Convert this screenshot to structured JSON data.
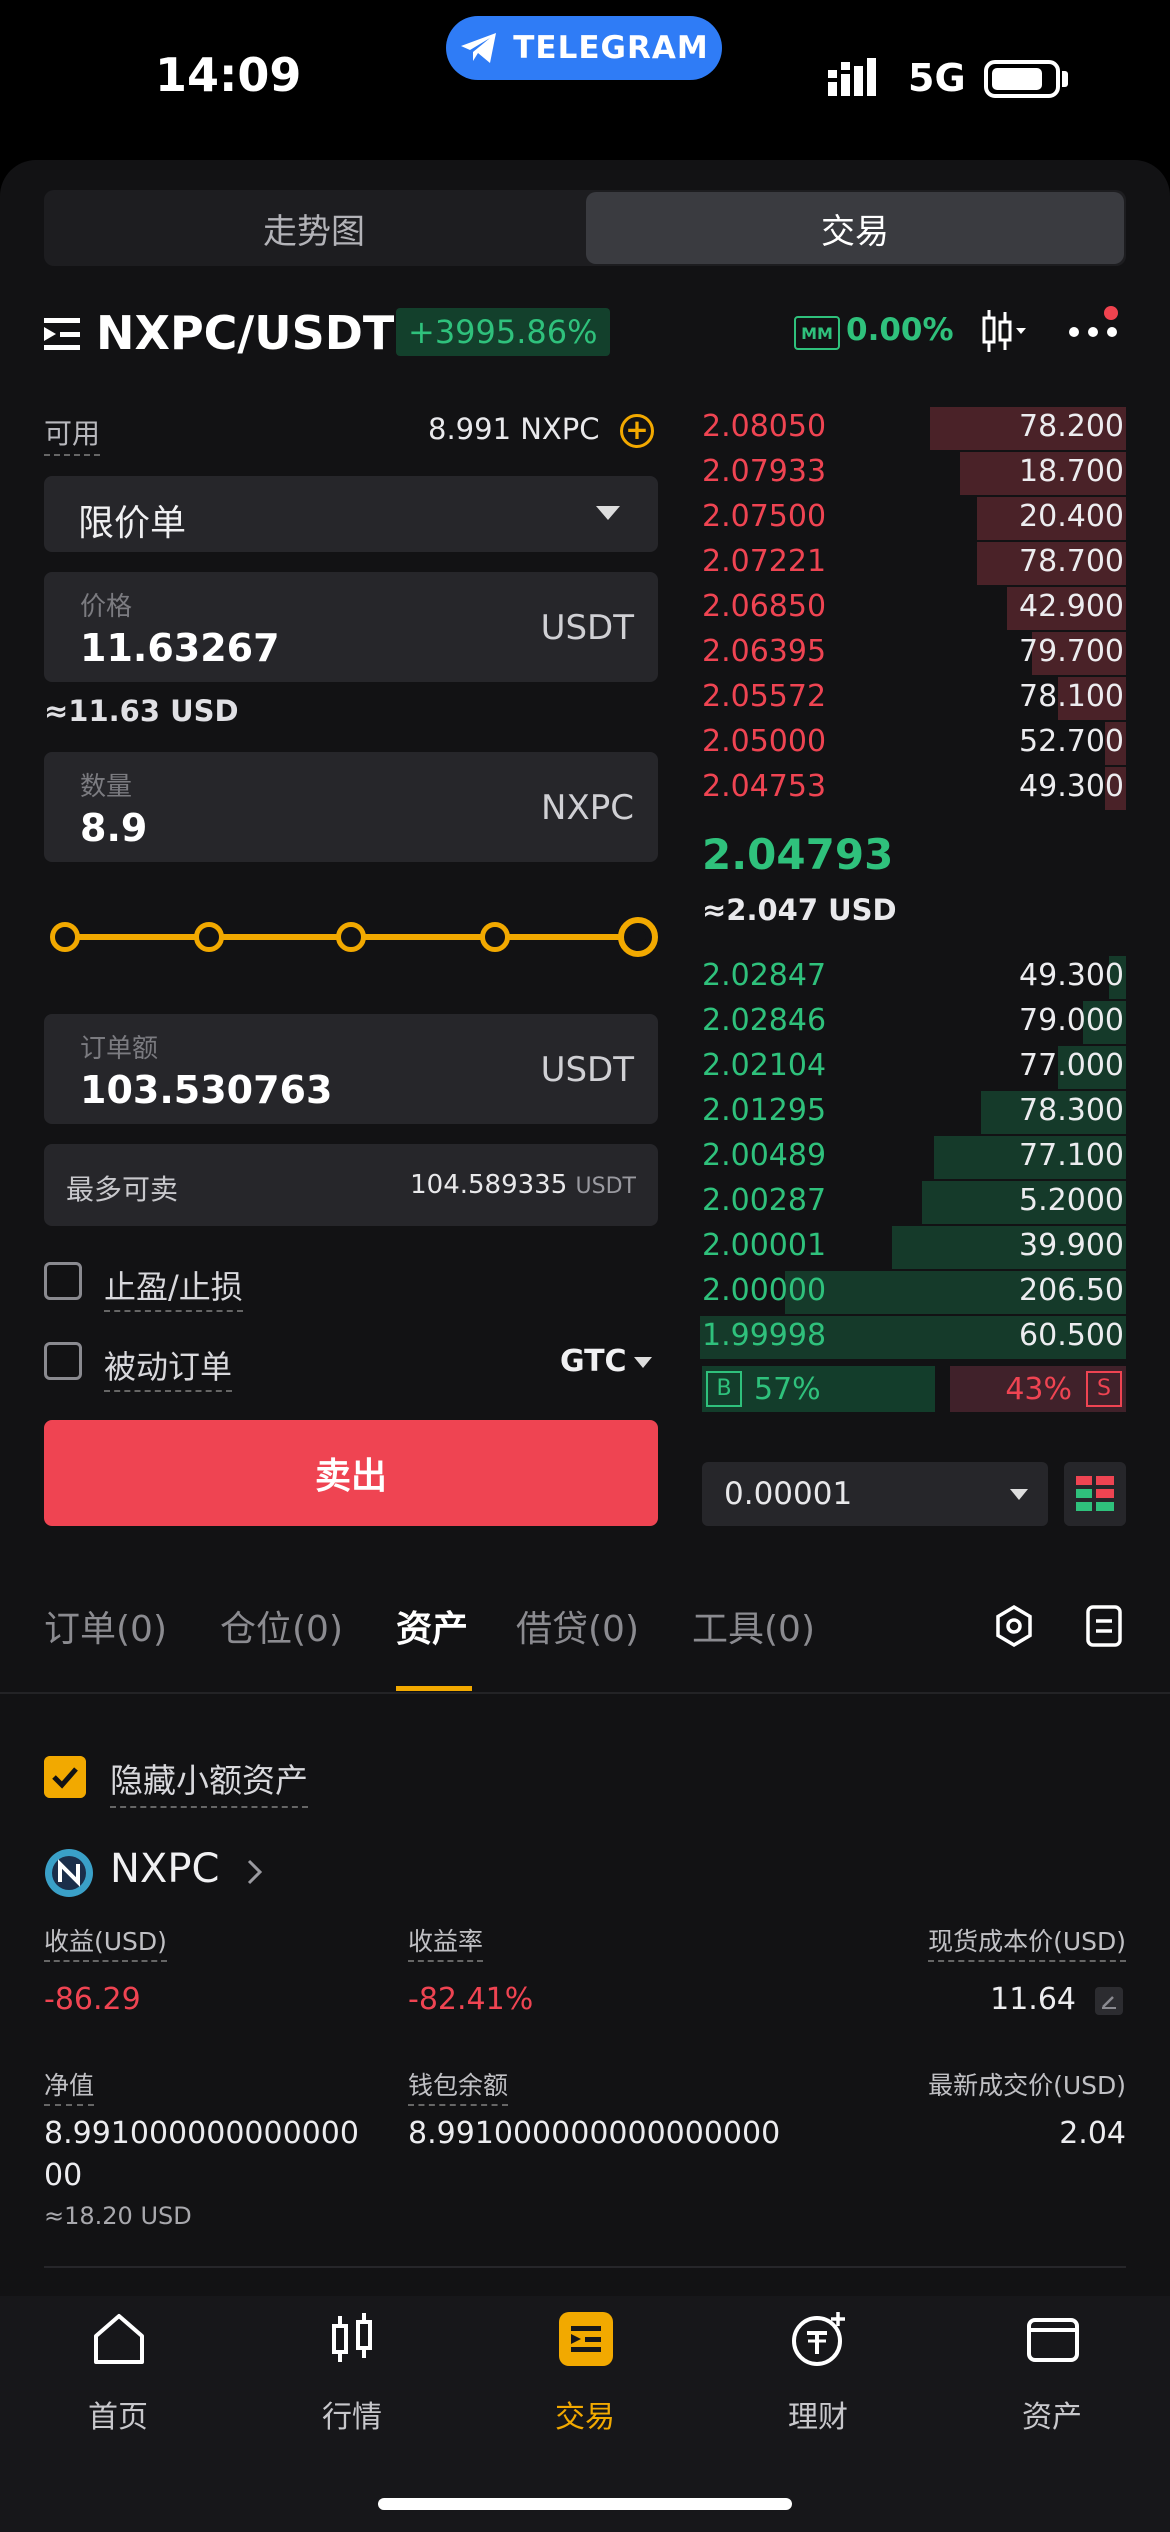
{
  "status": {
    "time": "14:09",
    "network": "5G",
    "pill_label": "TELEGRAM"
  },
  "top_tabs": [
    "走势图",
    "交易"
  ],
  "pair": {
    "symbol": "NXPC/USDT",
    "change": "+3995.86%",
    "mm_value": "0.00%"
  },
  "form": {
    "available_label": "可用",
    "available_value": "8.991 NXPC",
    "order_type": "限价单",
    "price_label": "价格",
    "price_value": "11.63267",
    "price_unit": "USDT",
    "price_usd": "≈11.63 USD",
    "qty_label": "数量",
    "qty_value": "8.9",
    "qty_unit": "NXPC",
    "slider_percent": 100,
    "amount_label": "订单额",
    "amount_value": "103.530763",
    "amount_unit": "USDT",
    "max_sell_label": "最多可卖",
    "max_sell_value": "104.589335",
    "max_sell_unit": "USDT",
    "tpsl_label": "止盈/止损",
    "passive_label": "被动订单",
    "tif": "GTC",
    "sell_button": "卖出"
  },
  "orderbook": {
    "asks": [
      {
        "price": "2.08050",
        "qty": "78.200",
        "depth": 0.46
      },
      {
        "price": "2.07933",
        "qty": "18.700",
        "depth": 0.39
      },
      {
        "price": "2.07500",
        "qty": "20.400",
        "depth": 0.35
      },
      {
        "price": "2.07221",
        "qty": "78.700",
        "depth": 0.35
      },
      {
        "price": "2.06850",
        "qty": "42.900",
        "depth": 0.28
      },
      {
        "price": "2.06395",
        "qty": "79.700",
        "depth": 0.22
      },
      {
        "price": "2.05572",
        "qty": "78.100",
        "depth": 0.16
      },
      {
        "price": "2.05000",
        "qty": "52.700",
        "depth": 0.05
      },
      {
        "price": "2.04753",
        "qty": "49.300",
        "depth": 0.05
      }
    ],
    "last_price": "2.04793",
    "last_usd": "≈2.047 USD",
    "bids": [
      {
        "price": "2.02847",
        "qty": "49.300",
        "depth": 0.04
      },
      {
        "price": "2.02846",
        "qty": "79.000",
        "depth": 0.1
      },
      {
        "price": "2.02104",
        "qty": "77.000",
        "depth": 0.16
      },
      {
        "price": "2.01295",
        "qty": "78.300",
        "depth": 0.34
      },
      {
        "price": "2.00489",
        "qty": "77.100",
        "depth": 0.45
      },
      {
        "price": "2.00287",
        "qty": "5.2000",
        "depth": 0.48
      },
      {
        "price": "2.00001",
        "qty": "39.900",
        "depth": 0.55
      },
      {
        "price": "2.00000",
        "qty": "206.50",
        "depth": 0.8
      },
      {
        "price": "1.99998",
        "qty": "60.500",
        "depth": 1.0
      }
    ],
    "buy_ratio_label": "B",
    "buy_ratio": "57%",
    "sell_ratio": "43%",
    "sell_ratio_label": "S",
    "precision": "0.00001"
  },
  "bottom_tabs": [
    "订单(0)",
    "仓位(0)",
    "资产",
    "借贷(0)",
    "工具(0)"
  ],
  "assets": {
    "hide_small_label": "隐藏小额资产",
    "coin": "NXPC",
    "pnl_label": "收益(USD)",
    "pnl_value": "-86.29",
    "pnl_rate_label": "收益率",
    "pnl_rate_value": "-82.41%",
    "cost_label": "现货成本价(USD)",
    "cost_value": "11.64",
    "net_label": "净值",
    "net_value_line1": "8.991000000000000",
    "net_value_line2": "00",
    "net_usd": "≈18.20 USD",
    "wallet_label": "钱包余额",
    "wallet_value": "8.991000000000000000",
    "last_trade_label": "最新成交价(USD)",
    "last_trade_value": "2.04"
  },
  "nav": [
    "首页",
    "行情",
    "交易",
    "理财",
    "资产"
  ],
  "colors": {
    "accent": "#f2a900",
    "sell": "#ef4452",
    "buy": "#2fc17c",
    "bg": "#121214"
  }
}
